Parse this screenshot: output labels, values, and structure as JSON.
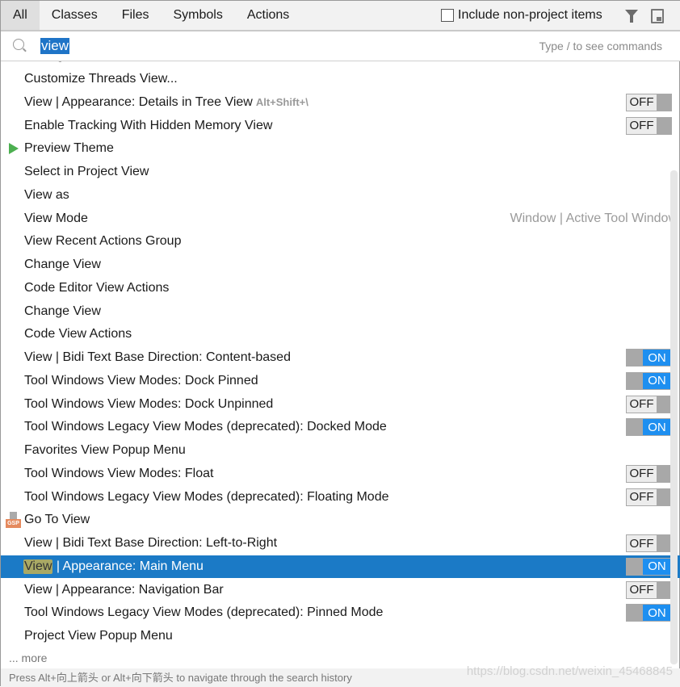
{
  "tabs": [
    {
      "label": "All",
      "active": true
    },
    {
      "label": "Classes"
    },
    {
      "label": "Files"
    },
    {
      "label": "Symbols"
    },
    {
      "label": "Actions"
    }
  ],
  "include_label": "Include non-project items",
  "include_checked": false,
  "search": {
    "value": "view",
    "hint": "Type / to see commands"
  },
  "items": [
    {
      "label": "Manage..."
    },
    {
      "label": "Customize Threads View..."
    },
    {
      "label": "View | Appearance: Details in Tree View",
      "shortcut": "Alt+Shift+\\",
      "toggle": "OFF"
    },
    {
      "label": "Enable Tracking With Hidden Memory View",
      "toggle": "OFF"
    },
    {
      "label": "Preview Theme",
      "icon": "play-icon"
    },
    {
      "label": "Select in Project View"
    },
    {
      "label": "View as"
    },
    {
      "label": "View Mode",
      "location": "Window | Active Tool Window"
    },
    {
      "label": "View Recent Actions Group"
    },
    {
      "label": "Change View"
    },
    {
      "label": "Code Editor View Actions"
    },
    {
      "label": "Change View"
    },
    {
      "label": "Code View Actions"
    },
    {
      "label": "View | Bidi Text Base Direction: Content-based",
      "toggle": "ON"
    },
    {
      "label": "Tool Windows View Modes: Dock Pinned",
      "toggle": "ON"
    },
    {
      "label": "Tool Windows View Modes: Dock Unpinned",
      "toggle": "OFF"
    },
    {
      "label": "Tool Windows Legacy View Modes (deprecated): Docked Mode",
      "toggle": "ON"
    },
    {
      "label": "Favorites View Popup Menu"
    },
    {
      "label": "Tool Windows View Modes: Float",
      "toggle": "OFF"
    },
    {
      "label": "Tool Windows Legacy View Modes (deprecated): Floating Mode",
      "toggle": "OFF"
    },
    {
      "label": "Go To View",
      "icon": "gsp-file-icon",
      "icon_text": "GSP"
    },
    {
      "label": "View | Bidi Text Base Direction: Left-to-Right",
      "toggle": "OFF"
    },
    {
      "label": "View | Appearance: Main Menu",
      "match": "View",
      "rest": " | Appearance: Main Menu",
      "toggle": "ON",
      "selected": true
    },
    {
      "label": "View | Appearance: Navigation Bar",
      "toggle": "OFF"
    },
    {
      "label": "Tool Windows Legacy View Modes (deprecated): Pinned Mode",
      "toggle": "ON"
    },
    {
      "label": "Project View Popup Menu"
    }
  ],
  "more": "... more",
  "footer": "Press Alt+向上箭头 or Alt+向下箭头 to navigate through the search history",
  "watermark": "https://blog.csdn.net/weixin_45468845",
  "colors": {
    "selection": "#1b7ac6",
    "toggle_on": "#1e8ff0",
    "match_highlight": "#a9a965"
  }
}
